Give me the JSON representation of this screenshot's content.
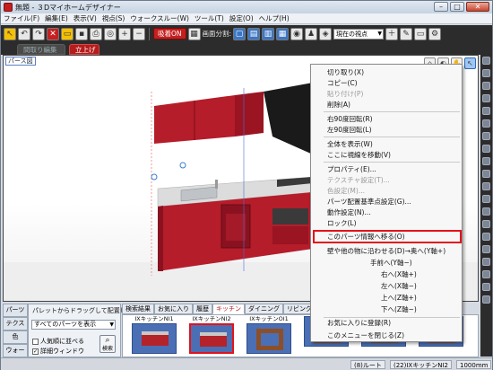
{
  "window": {
    "title": "無題 - ３Dマイホームデザイナー",
    "controls": {
      "minimize": "–",
      "maximize": "□",
      "close": "✕"
    }
  },
  "menubar": {
    "items": [
      "ファイル(F)",
      "編集(E)",
      "表示(V)",
      "視点(S)",
      "ウォークスルー(W)",
      "ツール(T)",
      "設定(O)",
      "ヘルプ(H)"
    ]
  },
  "toolbar": {
    "on_button": "吸着ON",
    "split_label": "画面分割:",
    "viewpoint_select": "現在の視点"
  },
  "view_tabs": {
    "tab1": "間取り編集",
    "tab2": "立上げ"
  },
  "viewport": {
    "label": "パース図"
  },
  "context_menu": {
    "items": [
      {
        "label": "切り取り(X)",
        "disabled": false
      },
      {
        "label": "コピー(C)",
        "disabled": false
      },
      {
        "label": "貼り付け(P)",
        "disabled": true
      },
      {
        "label": "削除(A)",
        "disabled": false
      },
      {
        "label": "右90度回転(R)",
        "disabled": false
      },
      {
        "label": "左90度回転(L)",
        "disabled": false
      },
      {
        "label": "全体を表示(W)",
        "disabled": false
      },
      {
        "label": "ここに視線を移動(V)",
        "disabled": false
      },
      {
        "label": "プロパティ(E)...",
        "disabled": false
      },
      {
        "label": "テクスチャ設定(T)...",
        "disabled": true
      },
      {
        "label": "色設定(M)...",
        "disabled": true
      },
      {
        "label": "パーツ配置基準点設定(G)...",
        "disabled": false
      },
      {
        "label": "動作設定(N)...",
        "disabled": false
      },
      {
        "label": "ロック(L)",
        "disabled": false
      },
      {
        "label": "このパーツ情報へ移る(O)",
        "disabled": false
      },
      {
        "label": "壁や他の物に沿わせる(D)→奥へ(Y軸+)",
        "disabled": false
      },
      {
        "label": "手前へ(Y軸−)",
        "disabled": false
      },
      {
        "label": "右へ(X軸+)",
        "disabled": false
      },
      {
        "label": "左へ(X軸−)",
        "disabled": false
      },
      {
        "label": "上へ(Z軸+)",
        "disabled": false
      },
      {
        "label": "下へ(Z軸−)",
        "disabled": false
      },
      {
        "label": "お気に入りに登録(R)",
        "disabled": false
      },
      {
        "label": "このメニューを閉じる(Z)",
        "disabled": false
      }
    ]
  },
  "bottom_panel": {
    "side_tabs": [
      "パーツ",
      "テクスチャ",
      "色",
      "ウォーク"
    ],
    "hint": "パレットからドラッグして配置します。",
    "filter_select": "すべてのパーツを表示",
    "checkbox_popular": "人気順に並べる",
    "checkbox_detail": "詳細ウィンドウ",
    "search_button": "検索",
    "parts_tabs": [
      "検索結果",
      "お気に入り",
      "履歴",
      "キッチン",
      "ダイニング",
      "リビング",
      "洗面",
      "トイ"
    ],
    "active_parts_tab": "キッチン",
    "thumbnails": [
      {
        "label": "IXキッチンNI1",
        "selected": false
      },
      {
        "label": "IXキッチンNI2",
        "selected": true
      },
      {
        "label": "IXキッチンOI1",
        "selected": false
      },
      {
        "label": "",
        "selected": false
      },
      {
        "label": "",
        "selected": false
      },
      {
        "label": "",
        "selected": false
      }
    ]
  },
  "statusbar": {
    "cell1": "(8)ルート",
    "cell2": "(22)IXキッチンNI2",
    "cell3": "1000mm"
  },
  "colors": {
    "accent_red": "#b51d1d",
    "highlight_border": "#e4121a",
    "toolbar_bg": "#2c2c2c"
  }
}
